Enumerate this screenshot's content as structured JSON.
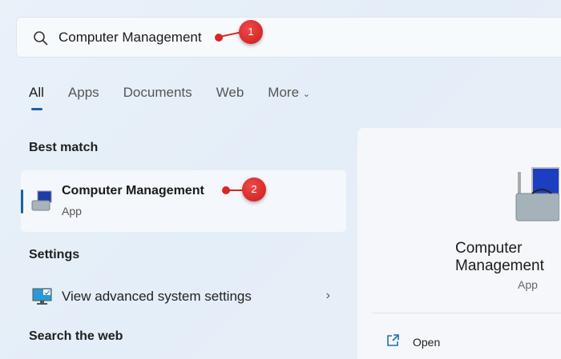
{
  "search": {
    "query": "Computer Management"
  },
  "annotations": {
    "step1": "1",
    "step2": "2"
  },
  "tabs": [
    {
      "label": "All"
    },
    {
      "label": "Apps"
    },
    {
      "label": "Documents"
    },
    {
      "label": "Web"
    },
    {
      "label": "More"
    }
  ],
  "sections": {
    "best_match": "Best match",
    "settings": "Settings",
    "search_web": "Search the web"
  },
  "best_match": {
    "title": "Computer Management",
    "subtitle": "App"
  },
  "settings_item": {
    "label": "View advanced system settings"
  },
  "detail": {
    "title": "Computer Management",
    "subtitle": "App",
    "open_label": "Open"
  },
  "colors": {
    "accent": "#1f5fa8",
    "marker": "#d92626"
  }
}
